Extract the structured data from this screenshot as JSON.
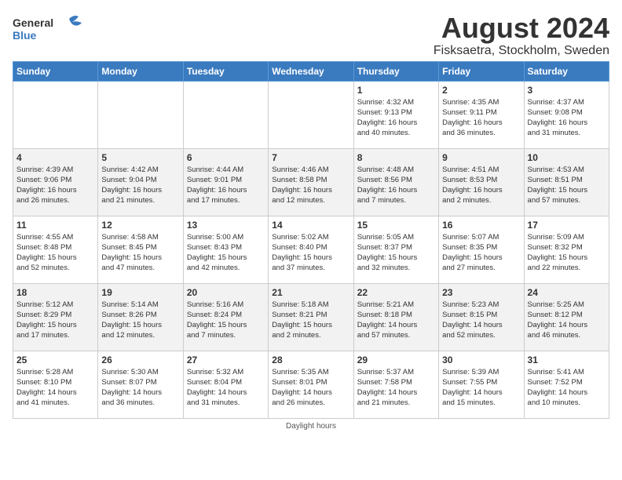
{
  "logo": {
    "text_general": "General",
    "text_blue": "Blue"
  },
  "header": {
    "month_year": "August 2024",
    "location": "Fisksaetra, Stockholm, Sweden"
  },
  "weekdays": [
    "Sunday",
    "Monday",
    "Tuesday",
    "Wednesday",
    "Thursday",
    "Friday",
    "Saturday"
  ],
  "weeks": [
    [
      {
        "day": "",
        "info": ""
      },
      {
        "day": "",
        "info": ""
      },
      {
        "day": "",
        "info": ""
      },
      {
        "day": "",
        "info": ""
      },
      {
        "day": "1",
        "info": "Sunrise: 4:32 AM\nSunset: 9:13 PM\nDaylight: 16 hours\nand 40 minutes."
      },
      {
        "day": "2",
        "info": "Sunrise: 4:35 AM\nSunset: 9:11 PM\nDaylight: 16 hours\nand 36 minutes."
      },
      {
        "day": "3",
        "info": "Sunrise: 4:37 AM\nSunset: 9:08 PM\nDaylight: 16 hours\nand 31 minutes."
      }
    ],
    [
      {
        "day": "4",
        "info": "Sunrise: 4:39 AM\nSunset: 9:06 PM\nDaylight: 16 hours\nand 26 minutes."
      },
      {
        "day": "5",
        "info": "Sunrise: 4:42 AM\nSunset: 9:04 PM\nDaylight: 16 hours\nand 21 minutes."
      },
      {
        "day": "6",
        "info": "Sunrise: 4:44 AM\nSunset: 9:01 PM\nDaylight: 16 hours\nand 17 minutes."
      },
      {
        "day": "7",
        "info": "Sunrise: 4:46 AM\nSunset: 8:58 PM\nDaylight: 16 hours\nand 12 minutes."
      },
      {
        "day": "8",
        "info": "Sunrise: 4:48 AM\nSunset: 8:56 PM\nDaylight: 16 hours\nand 7 minutes."
      },
      {
        "day": "9",
        "info": "Sunrise: 4:51 AM\nSunset: 8:53 PM\nDaylight: 16 hours\nand 2 minutes."
      },
      {
        "day": "10",
        "info": "Sunrise: 4:53 AM\nSunset: 8:51 PM\nDaylight: 15 hours\nand 57 minutes."
      }
    ],
    [
      {
        "day": "11",
        "info": "Sunrise: 4:55 AM\nSunset: 8:48 PM\nDaylight: 15 hours\nand 52 minutes."
      },
      {
        "day": "12",
        "info": "Sunrise: 4:58 AM\nSunset: 8:45 PM\nDaylight: 15 hours\nand 47 minutes."
      },
      {
        "day": "13",
        "info": "Sunrise: 5:00 AM\nSunset: 8:43 PM\nDaylight: 15 hours\nand 42 minutes."
      },
      {
        "day": "14",
        "info": "Sunrise: 5:02 AM\nSunset: 8:40 PM\nDaylight: 15 hours\nand 37 minutes."
      },
      {
        "day": "15",
        "info": "Sunrise: 5:05 AM\nSunset: 8:37 PM\nDaylight: 15 hours\nand 32 minutes."
      },
      {
        "day": "16",
        "info": "Sunrise: 5:07 AM\nSunset: 8:35 PM\nDaylight: 15 hours\nand 27 minutes."
      },
      {
        "day": "17",
        "info": "Sunrise: 5:09 AM\nSunset: 8:32 PM\nDaylight: 15 hours\nand 22 minutes."
      }
    ],
    [
      {
        "day": "18",
        "info": "Sunrise: 5:12 AM\nSunset: 8:29 PM\nDaylight: 15 hours\nand 17 minutes."
      },
      {
        "day": "19",
        "info": "Sunrise: 5:14 AM\nSunset: 8:26 PM\nDaylight: 15 hours\nand 12 minutes."
      },
      {
        "day": "20",
        "info": "Sunrise: 5:16 AM\nSunset: 8:24 PM\nDaylight: 15 hours\nand 7 minutes."
      },
      {
        "day": "21",
        "info": "Sunrise: 5:18 AM\nSunset: 8:21 PM\nDaylight: 15 hours\nand 2 minutes."
      },
      {
        "day": "22",
        "info": "Sunrise: 5:21 AM\nSunset: 8:18 PM\nDaylight: 14 hours\nand 57 minutes."
      },
      {
        "day": "23",
        "info": "Sunrise: 5:23 AM\nSunset: 8:15 PM\nDaylight: 14 hours\nand 52 minutes."
      },
      {
        "day": "24",
        "info": "Sunrise: 5:25 AM\nSunset: 8:12 PM\nDaylight: 14 hours\nand 46 minutes."
      }
    ],
    [
      {
        "day": "25",
        "info": "Sunrise: 5:28 AM\nSunset: 8:10 PM\nDaylight: 14 hours\nand 41 minutes."
      },
      {
        "day": "26",
        "info": "Sunrise: 5:30 AM\nSunset: 8:07 PM\nDaylight: 14 hours\nand 36 minutes."
      },
      {
        "day": "27",
        "info": "Sunrise: 5:32 AM\nSunset: 8:04 PM\nDaylight: 14 hours\nand 31 minutes."
      },
      {
        "day": "28",
        "info": "Sunrise: 5:35 AM\nSunset: 8:01 PM\nDaylight: 14 hours\nand 26 minutes."
      },
      {
        "day": "29",
        "info": "Sunrise: 5:37 AM\nSunset: 7:58 PM\nDaylight: 14 hours\nand 21 minutes."
      },
      {
        "day": "30",
        "info": "Sunrise: 5:39 AM\nSunset: 7:55 PM\nDaylight: 14 hours\nand 15 minutes."
      },
      {
        "day": "31",
        "info": "Sunrise: 5:41 AM\nSunset: 7:52 PM\nDaylight: 14 hours\nand 10 minutes."
      }
    ]
  ],
  "footer": {
    "note": "Daylight hours"
  }
}
